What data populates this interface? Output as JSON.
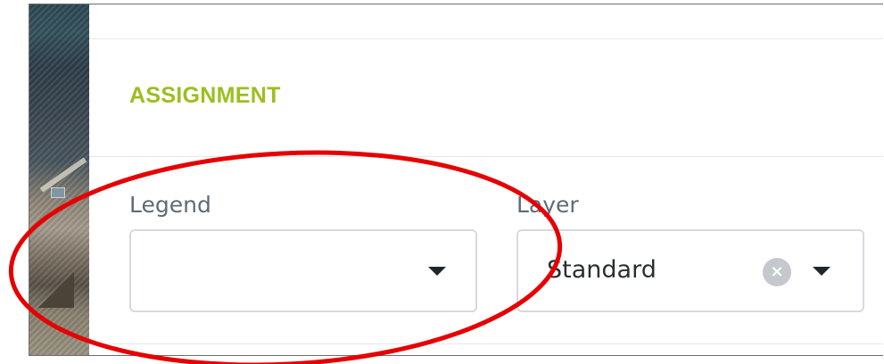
{
  "section": {
    "title": "ASSIGNMENT"
  },
  "legend_field": {
    "label": "Legend",
    "value": ""
  },
  "layer_field": {
    "label": "Layer",
    "value": "Standard"
  },
  "icons": {
    "legend_caret": "caret-down-icon",
    "layer_clear": "clear-icon",
    "layer_caret": "caret-down-icon"
  },
  "colors": {
    "section_title": "#9dbe1f",
    "annotation": "#e60000",
    "border": "#d6dadf"
  }
}
